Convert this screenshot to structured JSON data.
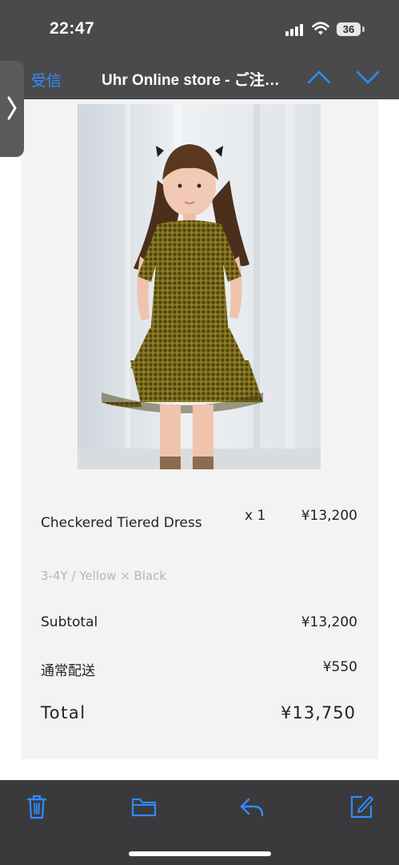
{
  "status_bar": {
    "time": "22:47",
    "battery": "36"
  },
  "nav": {
    "back_label": "受信",
    "title": "Uhr Online store - ご注…",
    "accent": "#2e8cff"
  },
  "order": {
    "item": {
      "name": "Checkered Tiered Dress",
      "quantity": "x 1",
      "price": "¥13,200",
      "variant": "3-4Y / Yellow × Black"
    },
    "subtotal": {
      "label": "Subtotal",
      "value": "¥13,200"
    },
    "shipping": {
      "label": "通常配送",
      "value": "¥550"
    },
    "total": {
      "label": "Total",
      "value": "¥13,750"
    }
  },
  "icons": [
    "chevron-right-icon",
    "chevron-up-icon",
    "chevron-down-icon",
    "trash-icon",
    "folder-icon",
    "reply-icon",
    "compose-icon"
  ]
}
